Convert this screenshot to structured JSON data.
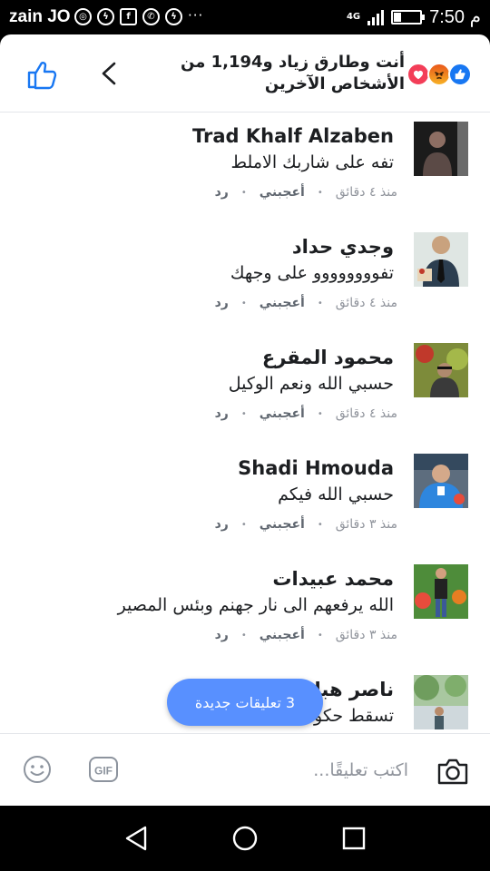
{
  "status_bar": {
    "carrier": "zain JO",
    "network": "4G",
    "time": "7:50 م",
    "notification_icons": [
      "location-icon",
      "messenger-icon",
      "facebook-icon",
      "whatsapp-icon",
      "messenger-icon",
      "more-dots-icon"
    ]
  },
  "header": {
    "title": "أنت وطارق زياد و1,194 من الأشخاص الآخرين",
    "reactions": [
      "like",
      "angry",
      "love"
    ]
  },
  "comments": [
    {
      "name": "Trad Khalf Alzaben",
      "text": "تفه على شاربك الاملط",
      "time": "منذ ٤ دقائق",
      "like_label": "أعجبني",
      "reply_label": "رد"
    },
    {
      "name": "وجدي حداد",
      "text": "تفوووووووو على وجهك",
      "time": "منذ ٤ دقائق",
      "like_label": "أعجبني",
      "reply_label": "رد"
    },
    {
      "name": "محمود المقرع",
      "text": "حسبي الله ونعم الوكيل",
      "time": "منذ ٤ دقائق",
      "like_label": "أعجبني",
      "reply_label": "رد"
    },
    {
      "name": "Shadi Hmouda",
      "text": "حسبي الله فيكم",
      "time": "منذ ٣ دقائق",
      "like_label": "أعجبني",
      "reply_label": "رد"
    },
    {
      "name": "محمد عبيدات",
      "text": "الله يرفعهم الى نار جهنم وبئس المصير",
      "time": "منذ ٣ دقائق",
      "like_label": "أعجبني",
      "reply_label": "رد"
    },
    {
      "name": "ناصر هبارنة",
      "text": "تسقط حكومة",
      "time": "",
      "like_label": "",
      "reply_label": ""
    }
  ],
  "new_comments_pill": "3 تعليقات جديدة",
  "composer": {
    "placeholder": "اكتب تعليقًا...",
    "gif_label": "GIF"
  },
  "colors": {
    "accent": "#1877f2",
    "pill": "#5890ff",
    "text_primary": "#1c1e21",
    "text_secondary": "#90949c"
  }
}
